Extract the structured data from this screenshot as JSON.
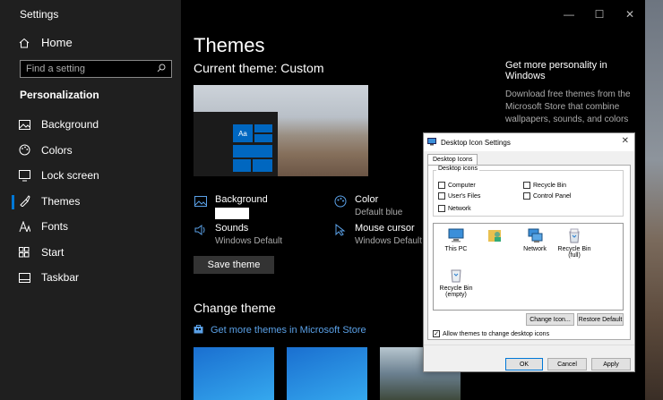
{
  "window": {
    "title": "Settings"
  },
  "sidebar": {
    "home": "Home",
    "search_placeholder": "Find a setting",
    "section": "Personalization",
    "items": [
      {
        "label": "Background",
        "icon": "image-icon"
      },
      {
        "label": "Colors",
        "icon": "palette-icon"
      },
      {
        "label": "Lock screen",
        "icon": "lock-screen-icon"
      },
      {
        "label": "Themes",
        "icon": "brush-icon",
        "active": true
      },
      {
        "label": "Fonts",
        "icon": "font-icon"
      },
      {
        "label": "Start",
        "icon": "start-icon"
      },
      {
        "label": "Taskbar",
        "icon": "taskbar-icon"
      }
    ]
  },
  "main": {
    "title": "Themes",
    "current_theme": "Current theme: Custom",
    "preview_tile": "Aa",
    "attributes": {
      "background": {
        "label": "Background"
      },
      "color": {
        "label": "Color",
        "value": "Default blue"
      },
      "sounds": {
        "label": "Sounds",
        "value": "Windows Default"
      },
      "cursor": {
        "label": "Mouse cursor",
        "value": "Windows Default"
      }
    },
    "save_button": "Save theme",
    "change_title": "Change theme",
    "store_link": "Get more themes in Microsoft Store"
  },
  "personality": {
    "heading": "Get more personality in Windows",
    "body": "Download free themes from the Microsoft Store that combine wallpapers, sounds, and colors"
  },
  "dialog": {
    "title": "Desktop Icon Settings",
    "tab": "Desktop Icons",
    "group_label": "Desktop icons",
    "checkboxes": {
      "computer": "Computer",
      "recycle_bin": "Recycle Bin",
      "users_files": "User's Files",
      "control_panel": "Control Panel",
      "network": "Network"
    },
    "icons": {
      "this_pc": "This PC",
      "network": "Network",
      "recycle_full": "Recycle Bin (full)",
      "recycle_empty": "Recycle Bin (empty)"
    },
    "change_icon": "Change Icon...",
    "restore_default": "Restore Default",
    "allow_themes": "Allow themes to change desktop icons",
    "ok": "OK",
    "cancel": "Cancel",
    "apply": "Apply"
  },
  "colors": {
    "accent": "#0078d7",
    "link": "#5aa0e6"
  }
}
